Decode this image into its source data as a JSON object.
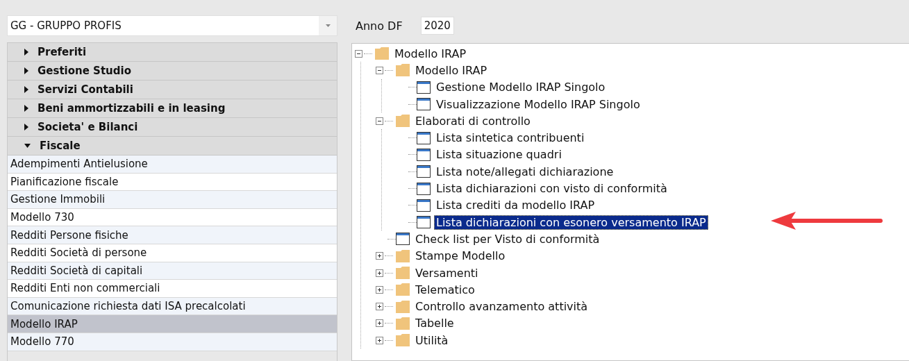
{
  "company_select": {
    "value": "GG - GRUPPO PROFIS"
  },
  "year_field": {
    "label": "Anno DF",
    "value": "2020"
  },
  "sidebar": {
    "sections": [
      {
        "label": "Preferiti",
        "expanded": false
      },
      {
        "label": "Gestione Studio",
        "expanded": false
      },
      {
        "label": "Servizi Contabili",
        "expanded": false
      },
      {
        "label": "Beni ammortizzabili e in leasing",
        "expanded": false
      },
      {
        "label": "Societa' e Bilanci",
        "expanded": false
      },
      {
        "label": "Fiscale",
        "expanded": true,
        "items": [
          {
            "label": "Adempimenti Antielusione",
            "selected": false
          },
          {
            "label": "Pianificazione fiscale",
            "selected": false
          },
          {
            "label": "Gestione Immobili",
            "selected": false
          },
          {
            "label": "Modello 730",
            "selected": false
          },
          {
            "label": "Redditi Persone fisiche",
            "selected": false
          },
          {
            "label": "Redditi Società di persone",
            "selected": false
          },
          {
            "label": "Redditi Società di capitali",
            "selected": false
          },
          {
            "label": "Redditi Enti non commerciali",
            "selected": false
          },
          {
            "label": "Comunicazione richiesta dati ISA precalcolati",
            "selected": false
          },
          {
            "label": "Modello IRAP",
            "selected": true
          },
          {
            "label": "Modello 770",
            "selected": false
          }
        ]
      }
    ]
  },
  "tree": {
    "nodes": [
      {
        "kind": "folder",
        "label": "Modello IRAP",
        "expanded": true,
        "selected": false,
        "children": [
          {
            "kind": "folder",
            "label": "Modello IRAP",
            "expanded": true,
            "selected": false,
            "children": [
              {
                "kind": "window",
                "label": "Gestione Modello IRAP Singolo",
                "selected": false
              },
              {
                "kind": "window",
                "label": "Visualizzazione Modello IRAP Singolo",
                "selected": false
              }
            ]
          },
          {
            "kind": "folder",
            "label": "Elaborati di controllo",
            "expanded": true,
            "selected": false,
            "children": [
              {
                "kind": "window",
                "label": "Lista sintetica contribuenti",
                "selected": false
              },
              {
                "kind": "window",
                "label": "Lista situazione quadri",
                "selected": false
              },
              {
                "kind": "window",
                "label": "Lista note/allegati dichiarazione",
                "selected": false
              },
              {
                "kind": "window",
                "label": "Lista dichiarazioni con visto di conformità",
                "selected": false
              },
              {
                "kind": "window",
                "label": "Lista crediti da modello IRAP",
                "selected": false
              },
              {
                "kind": "window",
                "label": "Lista dichiarazioni con esonero versamento IRAP",
                "selected": true
              }
            ]
          },
          {
            "kind": "window",
            "label": "Check list per Visto di conformità",
            "selected": false
          },
          {
            "kind": "folder",
            "label": "Stampe Modello",
            "expanded": false,
            "selected": false
          },
          {
            "kind": "folder",
            "label": "Versamenti",
            "expanded": false,
            "selected": false
          },
          {
            "kind": "folder",
            "label": "Telematico",
            "expanded": false,
            "selected": false
          },
          {
            "kind": "folder",
            "label": "Controllo avanzamento attività",
            "expanded": false,
            "selected": false
          },
          {
            "kind": "folder",
            "label": "Tabelle",
            "expanded": false,
            "selected": false
          },
          {
            "kind": "folder",
            "label": "Utilità",
            "expanded": false,
            "selected": false
          }
        ]
      }
    ]
  }
}
